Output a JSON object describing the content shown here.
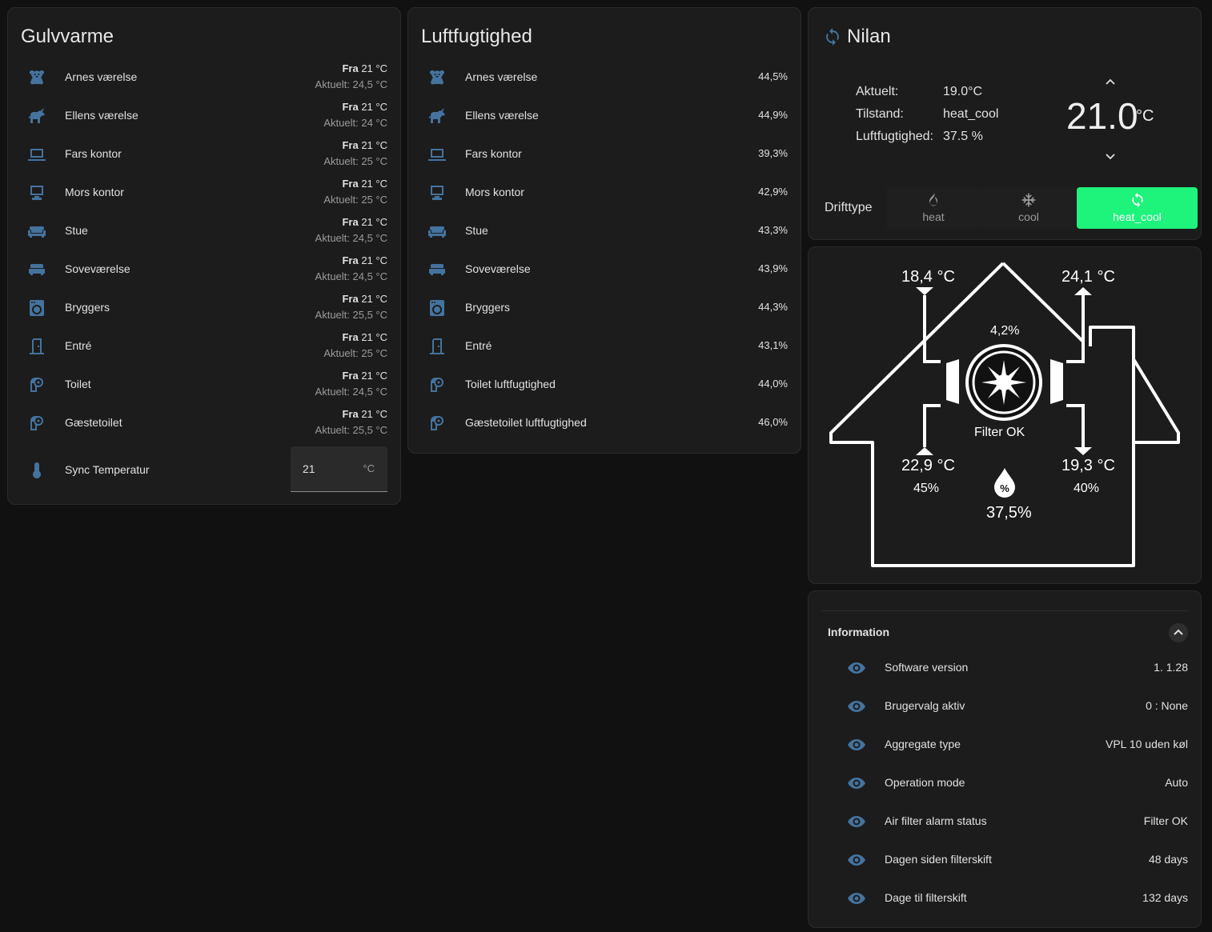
{
  "gulvvarme": {
    "title": "Gulvvarme",
    "rows": [
      {
        "icon": "teddy-bear-icon",
        "label": "Arnes værelse",
        "setpoint_prefix": "Fra",
        "setpoint": "21 °C",
        "actual": "Aktuelt: 24,5 °C"
      },
      {
        "icon": "unicorn-icon",
        "label": "Ellens værelse",
        "setpoint_prefix": "Fra",
        "setpoint": "21 °C",
        "actual": "Aktuelt: 24 °C"
      },
      {
        "icon": "laptop-icon",
        "label": "Fars kontor",
        "setpoint_prefix": "Fra",
        "setpoint": "21 °C",
        "actual": "Aktuelt: 25 °C"
      },
      {
        "icon": "desktop-computer-icon",
        "label": "Mors kontor",
        "setpoint_prefix": "Fra",
        "setpoint": "21 °C",
        "actual": "Aktuelt: 25 °C"
      },
      {
        "icon": "sofa-icon",
        "label": "Stue",
        "setpoint_prefix": "Fra",
        "setpoint": "21 °C",
        "actual": "Aktuelt: 24,5 °C"
      },
      {
        "icon": "bed-icon",
        "label": "Soveværelse",
        "setpoint_prefix": "Fra",
        "setpoint": "21 °C",
        "actual": "Aktuelt: 24,5 °C"
      },
      {
        "icon": "washing-machine-icon",
        "label": "Bryggers",
        "setpoint_prefix": "Fra",
        "setpoint": "21 °C",
        "actual": "Aktuelt: 25,5 °C"
      },
      {
        "icon": "door-icon",
        "label": "Entré",
        "setpoint_prefix": "Fra",
        "setpoint": "21 °C",
        "actual": "Aktuelt: 25 °C"
      },
      {
        "icon": "toilet-paper-icon",
        "label": "Toilet",
        "setpoint_prefix": "Fra",
        "setpoint": "21 °C",
        "actual": "Aktuelt: 24,5 °C"
      },
      {
        "icon": "toilet-paper-icon",
        "label": "Gæstetoilet",
        "setpoint_prefix": "Fra",
        "setpoint": "21 °C",
        "actual": "Aktuelt: 25,5 °C"
      }
    ],
    "sync": {
      "icon": "thermometer-icon",
      "label": "Sync Temperatur",
      "value": "21",
      "unit": "°C"
    }
  },
  "luftfugtighed": {
    "title": "Luftfugtighed",
    "rows": [
      {
        "icon": "teddy-bear-icon",
        "label": "Arnes værelse",
        "value": "44,5%"
      },
      {
        "icon": "unicorn-icon",
        "label": "Ellens værelse",
        "value": "44,9%"
      },
      {
        "icon": "laptop-icon",
        "label": "Fars kontor",
        "value": "39,3%"
      },
      {
        "icon": "desktop-computer-icon",
        "label": "Mors kontor",
        "value": "42,9%"
      },
      {
        "icon": "sofa-icon",
        "label": "Stue",
        "value": "43,3%"
      },
      {
        "icon": "bed-icon",
        "label": "Soveværelse",
        "value": "43,9%"
      },
      {
        "icon": "washing-machine-icon",
        "label": "Bryggers",
        "value": "44,3%"
      },
      {
        "icon": "door-icon",
        "label": "Entré",
        "value": "43,1%"
      },
      {
        "icon": "toilet-paper-icon",
        "label": "Toilet luftfugtighed",
        "value": "44,0%"
      },
      {
        "icon": "toilet-paper-icon",
        "label": "Gæstetoilet luftfugtighed",
        "value": "46,0%"
      }
    ]
  },
  "nilan": {
    "title": "Nilan",
    "icon": "sync-icon",
    "current_label": "Aktuelt:",
    "current_value": "19.0°C",
    "state_label": "Tilstand:",
    "state_value": "heat_cool",
    "humidity_label": "Luftfugtighed:",
    "humidity_value": "37.5 %",
    "target_temp": "21.0",
    "target_unit": "°C",
    "mode_label": "Drifttype",
    "modes": [
      {
        "icon": "fire-icon",
        "label": "heat",
        "active": false
      },
      {
        "icon": "snowflake-icon",
        "label": "cool",
        "active": false
      },
      {
        "icon": "sync-icon",
        "label": "heat_cool",
        "active": true
      }
    ],
    "active_color": "#1ef37c"
  },
  "house": {
    "outdoor_temp": "18,4 °C",
    "exhaust_temp": "24,1 °C",
    "supply_temp": "22,9 °C",
    "extract_temp": "19,3 °C",
    "supply_humidity": "45%",
    "extract_humidity": "40%",
    "fan_value": "4,2%",
    "filter_status": "Filter OK",
    "indoor_humidity": "37,5%"
  },
  "information": {
    "header": "Information",
    "rows": [
      {
        "label": "Software version",
        "value": "1. 1.28"
      },
      {
        "label": "Brugervalg aktiv",
        "value": "0 : None"
      },
      {
        "label": "Aggregate type",
        "value": "VPL 10 uden køl"
      },
      {
        "label": "Operation mode",
        "value": "Auto"
      },
      {
        "label": "Air filter alarm status",
        "value": "Filter OK"
      },
      {
        "label": "Dagen siden filterskift",
        "value": "48 days"
      },
      {
        "label": "Dage til filterskift",
        "value": "132 days"
      }
    ]
  },
  "colors": {
    "icon_blue": "#44739e",
    "background": "#111111",
    "card": "#1c1c1c"
  }
}
